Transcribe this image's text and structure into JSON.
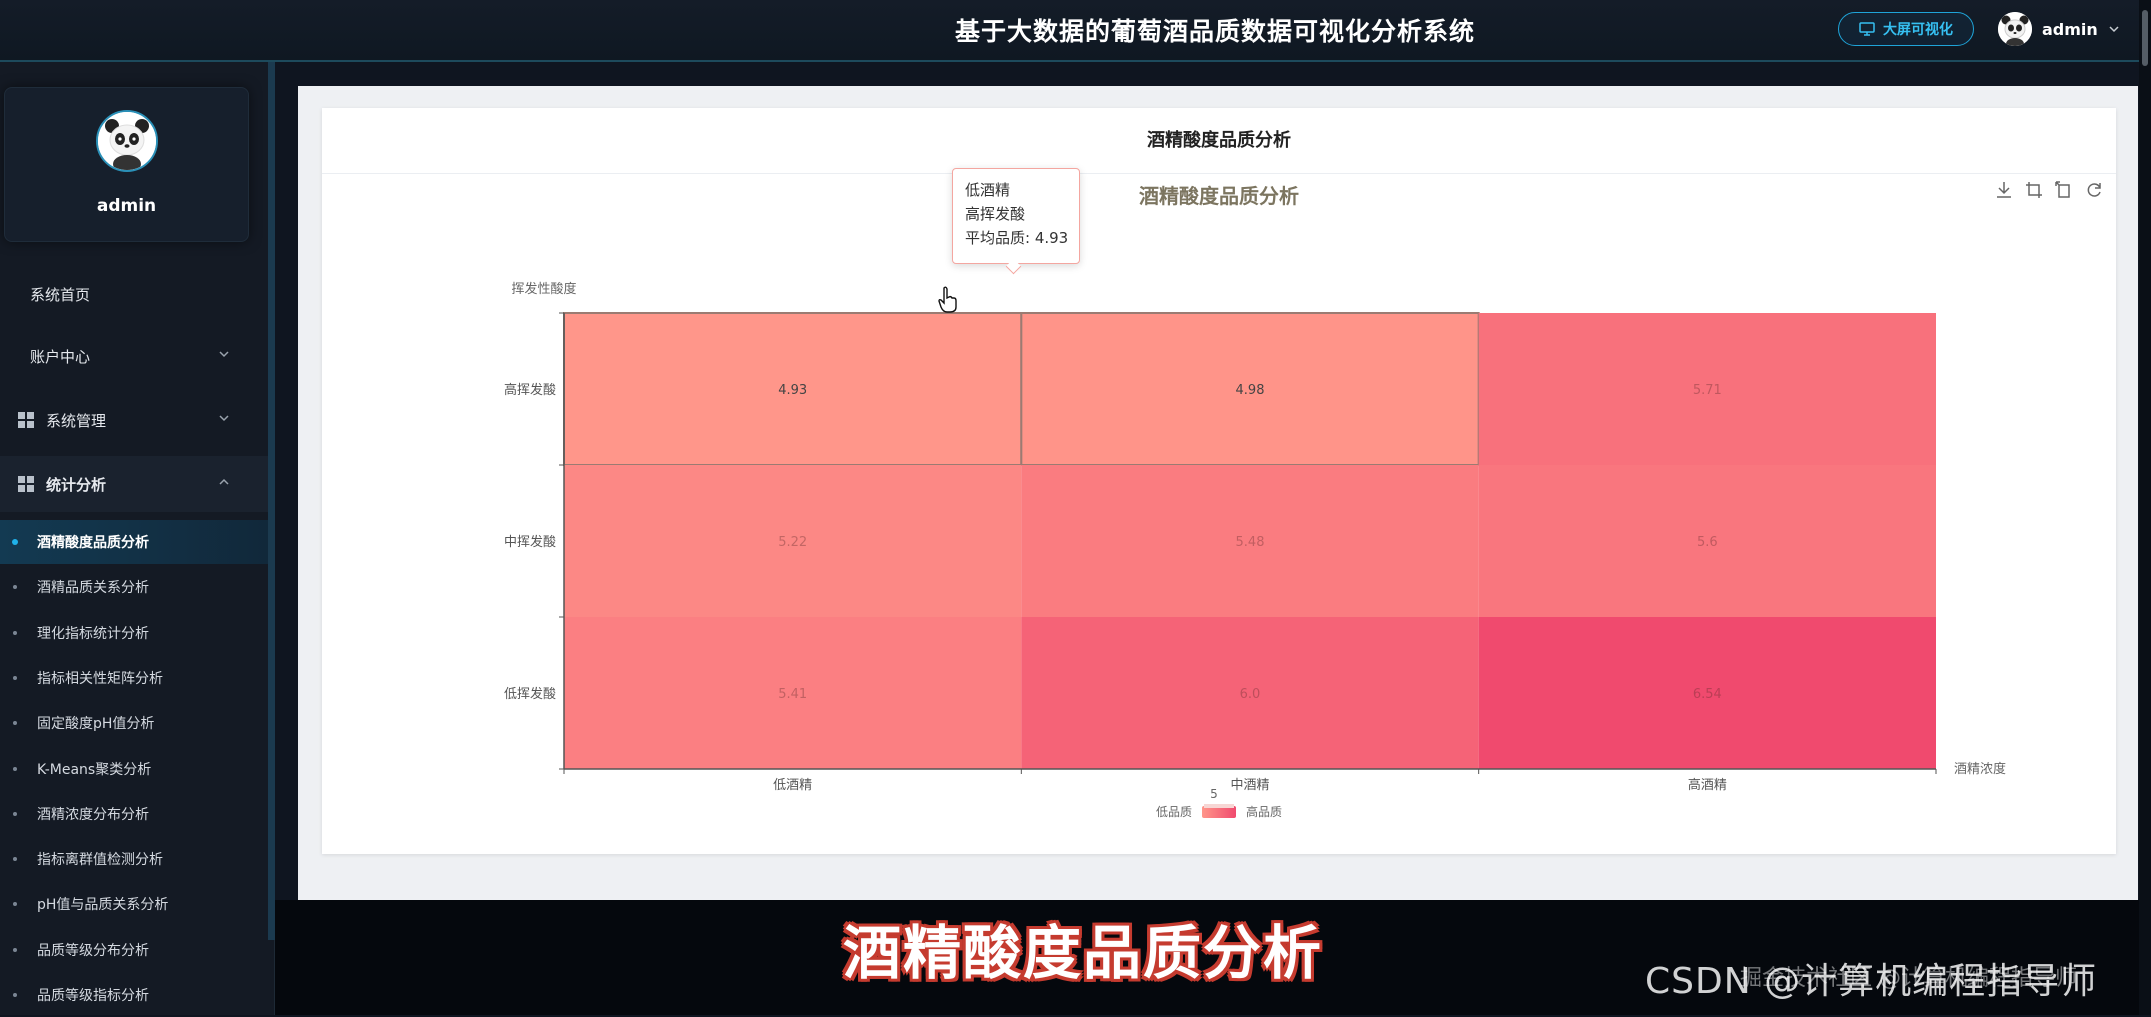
{
  "header": {
    "title": "基于大数据的葡萄酒品质数据可视化分析系统",
    "big_screen_label": "大屏可视化",
    "user_name": "admin"
  },
  "sidebar": {
    "profile_name": "admin",
    "menu": [
      {
        "label": "系统首页"
      },
      {
        "label": "账户中心"
      },
      {
        "label": "系统管理"
      },
      {
        "label": "统计分析"
      }
    ],
    "sub_items": [
      {
        "label": "酒精酸度品质分析",
        "active": true
      },
      {
        "label": "酒精品质关系分析"
      },
      {
        "label": "理化指标统计分析"
      },
      {
        "label": "指标相关性矩阵分析"
      },
      {
        "label": "固定酸度pH值分析"
      },
      {
        "label": "K-Means聚类分析"
      },
      {
        "label": "酒精浓度分布分析"
      },
      {
        "label": "指标离群值检测分析"
      },
      {
        "label": "pH值与品质关系分析"
      },
      {
        "label": "品质等级分布分析"
      },
      {
        "label": "品质等级指标分析"
      }
    ]
  },
  "card": {
    "title": "酒精酸度品质分析"
  },
  "tooltip": {
    "line1": "低酒精",
    "line2": "高挥发酸",
    "line3": "平均品质: 4.93"
  },
  "caption": "酒精酸度品质分析",
  "watermark": "CSDN @计算机编程指导师",
  "watermark_overlay": "掘金技术社区 @计算机编程指导师",
  "chart_data": {
    "type": "heatmap",
    "title": "酒精酸度品质分析",
    "ylabel": "挥发性酸度",
    "xlabel": "酒精浓度",
    "x_categories": [
      "低酒精",
      "中酒精",
      "高酒精"
    ],
    "y_categories": [
      "高挥发酸",
      "中挥发酸",
      "低挥发酸"
    ],
    "values": [
      {
        "x": "低酒精",
        "y": "高挥发酸",
        "value": 4.93,
        "label": "4.93"
      },
      {
        "x": "中酒精",
        "y": "高挥发酸",
        "value": 4.98,
        "label": "4.98"
      },
      {
        "x": "高酒精",
        "y": "高挥发酸",
        "value": 5.71,
        "label": "5.71"
      },
      {
        "x": "低酒精",
        "y": "中挥发酸",
        "value": 5.22,
        "label": "5.22"
      },
      {
        "x": "中酒精",
        "y": "中挥发酸",
        "value": 5.48,
        "label": "5.48"
      },
      {
        "x": "高酒精",
        "y": "中挥发酸",
        "value": 5.6,
        "label": "5.6"
      },
      {
        "x": "低酒精",
        "y": "低挥发酸",
        "value": 5.41,
        "label": "5.41"
      },
      {
        "x": "中酒精",
        "y": "低挥发酸",
        "value": 6.0,
        "label": "6.0"
      },
      {
        "x": "高酒精",
        "y": "低挥发酸",
        "value": 6.54,
        "label": "6.54"
      }
    ],
    "visual_map": {
      "min_label": "低品质",
      "max_label": "高品质",
      "value_label": "5",
      "color_low": "#ff968a",
      "color_high": "#f04a6e"
    },
    "highlighted_cell": {
      "x": "低酒精",
      "y": "高挥发酸"
    }
  }
}
